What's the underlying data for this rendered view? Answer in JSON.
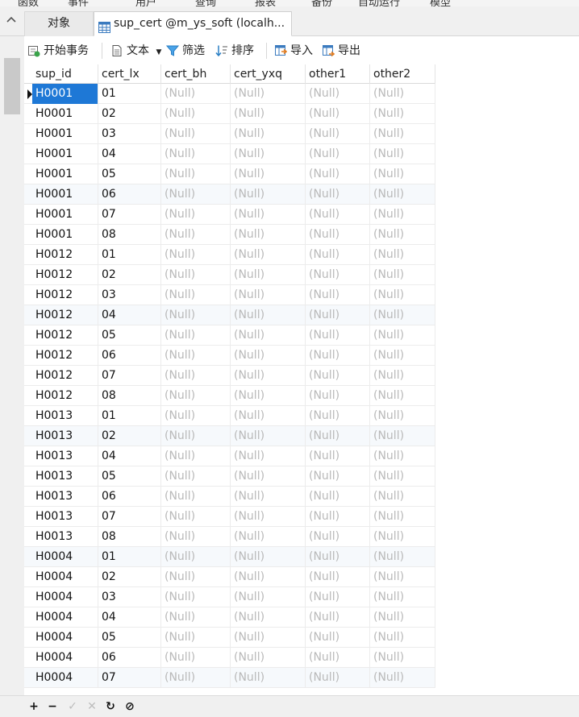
{
  "menu": {
    "items": [
      "函数",
      "事件",
      "用户",
      "查询",
      "报表",
      "备份",
      "自动运行",
      "模型"
    ]
  },
  "tabs": {
    "objects_label": "对象",
    "active_label": "sup_cert @m_ys_soft (localh..."
  },
  "toolbar": {
    "begin_transaction": "开始事务",
    "text": "文本",
    "filter": "筛选",
    "sort": "排序",
    "import": "导入",
    "export": "导出"
  },
  "grid": {
    "columns": [
      "sup_id",
      "cert_lx",
      "cert_bh",
      "cert_yxq",
      "other1",
      "other2"
    ],
    "null_text": "(Null)",
    "rows": [
      [
        "H0001",
        "01"
      ],
      [
        "H0001",
        "02"
      ],
      [
        "H0001",
        "03"
      ],
      [
        "H0001",
        "04"
      ],
      [
        "H0001",
        "05"
      ],
      [
        "H0001",
        "06"
      ],
      [
        "H0001",
        "07"
      ],
      [
        "H0001",
        "08"
      ],
      [
        "H0012",
        "01"
      ],
      [
        "H0012",
        "02"
      ],
      [
        "H0012",
        "03"
      ],
      [
        "H0012",
        "04"
      ],
      [
        "H0012",
        "05"
      ],
      [
        "H0012",
        "06"
      ],
      [
        "H0012",
        "07"
      ],
      [
        "H0012",
        "08"
      ],
      [
        "H0013",
        "01"
      ],
      [
        "H0013",
        "02"
      ],
      [
        "H0013",
        "04"
      ],
      [
        "H0013",
        "05"
      ],
      [
        "H0013",
        "06"
      ],
      [
        "H0013",
        "07"
      ],
      [
        "H0013",
        "08"
      ],
      [
        "H0004",
        "01"
      ],
      [
        "H0004",
        "02"
      ],
      [
        "H0004",
        "03"
      ],
      [
        "H0004",
        "04"
      ],
      [
        "H0004",
        "05"
      ],
      [
        "H0004",
        "06"
      ],
      [
        "H0004",
        "07"
      ]
    ]
  },
  "bottom_toolbar": {
    "add": "+",
    "delete": "−",
    "apply": "✓",
    "discard": "✕",
    "refresh": "↻",
    "stop": "⊘"
  },
  "colors": {
    "selection": "#1e78d6",
    "null_text": "#b9b9b9",
    "alt_row": "#f6f9fc"
  }
}
